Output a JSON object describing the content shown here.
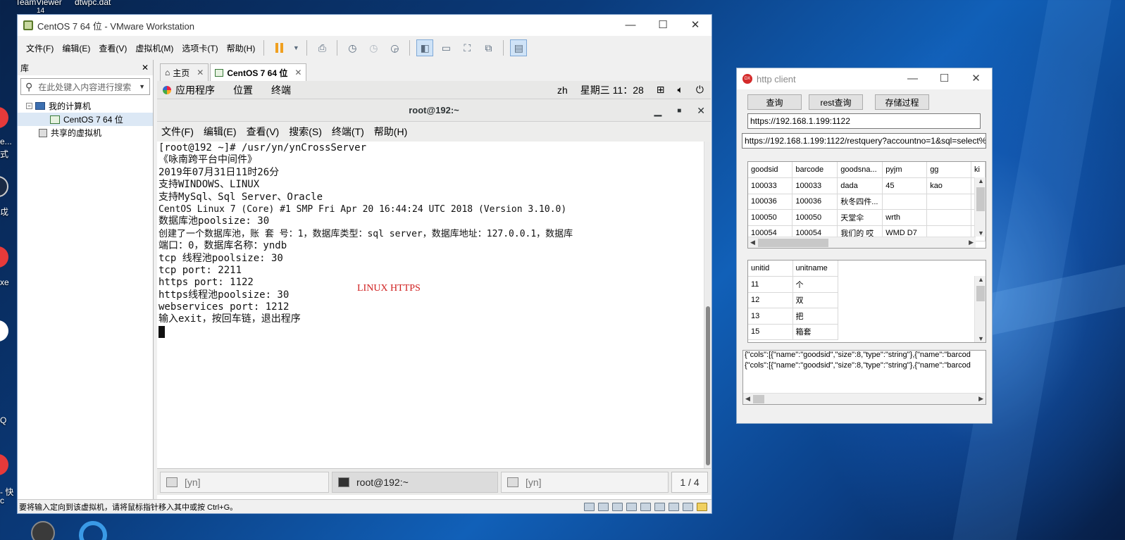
{
  "desktop": {
    "top_icons": [
      "TeamViewer",
      "dtwpc.dat"
    ],
    "top_sub": "14",
    "left_labels": [
      "e...",
      "式",
      "戉",
      "xe",
      "Q",
      "- 快",
      "c"
    ]
  },
  "vmware": {
    "title": "CentOS 7 64 位 - VMware Workstation",
    "controls": {
      "minimize": "—",
      "maximize": "☐",
      "close": "✕"
    },
    "menu": [
      "文件(F)",
      "编辑(E)",
      "查看(V)",
      "虚拟机(M)",
      "选项卡(T)",
      "帮助(H)"
    ],
    "library": {
      "title": "库",
      "close": "✕",
      "search_placeholder": "在此处键入内容进行搜索",
      "tree": {
        "root": "我的计算机",
        "vm": "CentOS 7 64 位",
        "shared": "共享的虚拟机"
      }
    },
    "tabs": [
      {
        "label": "主页"
      },
      {
        "label": "CentOS 7 64 位"
      }
    ],
    "status_text": "要将输入定向到该虚拟机，请将鼠标指针移入其中或按 Ctrl+G。"
  },
  "gnome": {
    "menu": [
      "应用程序",
      "位置",
      "终端"
    ],
    "lang": "zh",
    "clock": "星期三 11：28"
  },
  "terminal": {
    "title": "root@192:~",
    "menu": [
      "文件(F)",
      "编辑(E)",
      "查看(V)",
      "搜索(S)",
      "终端(T)",
      "帮助(H)"
    ],
    "lines": [
      "[root@192 ~]# /usr/yn/ynCrossServer",
      "《咏南跨平台中间件》",
      "2019年07月31日11时26分",
      "支持WINDOWS、LINUX",
      "支持MySql、Sql Server、Oracle",
      "CentOS Linux 7 (Core) #1 SMP Fri Apr 20 16:44:24 UTC 2018 (Version 3.10.0)",
      "数据库池poolsize: 30",
      "创建了一个数据库池，账 套 号：1，数据库类型：sql server，数据库地址：127.0.0.1，数据库",
      "端口：0，数据库名称：yndb",
      "tcp 线程池poolsize: 30",
      "tcp port: 2211",
      "https port: 1122",
      "https线程池poolsize: 30",
      "webservices port: 1212",
      "输入exit，按回车链，退出程序"
    ],
    "annotation": "LINUX HTTPS",
    "taskbar": [
      {
        "label": "[yn]"
      },
      {
        "label": "root@192:~"
      },
      {
        "label": "[yn]"
      }
    ],
    "pager": "1 / 4"
  },
  "http_client": {
    "title": "http client",
    "buttons": [
      "查询",
      "rest查询",
      "存储过程"
    ],
    "url": "https://192.168.1.199:1122",
    "rest_url": "https://192.168.1.199:1122/restquery?accountno=1&sql=select%2",
    "grid1": {
      "columns": [
        "goodsid",
        "barcode",
        "goodsna...",
        "pyjm",
        "gg",
        "ki"
      ],
      "rows": [
        [
          "100033",
          "100033",
          "dada",
          "45",
          "kao",
          ""
        ],
        [
          "100036",
          "100036",
          "秋冬四件...",
          "",
          "",
          ""
        ],
        [
          "100050",
          "100050",
          "天堂伞",
          "wrth",
          "",
          ""
        ],
        [
          "100054",
          "100054",
          "我们的 哎",
          "WMD D7",
          "",
          ""
        ]
      ]
    },
    "grid2": {
      "columns": [
        "unitid",
        "unitname"
      ],
      "rows": [
        [
          "11",
          "个"
        ],
        [
          "12",
          "双"
        ],
        [
          "13",
          "把"
        ],
        [
          "15",
          "箱套"
        ]
      ]
    },
    "memo": [
      "{\"cols\":[{\"name\":\"goodsid\",\"size\":8,\"type\":\"string\"},{\"name\":\"barcod",
      "{\"cols\":[{\"name\":\"goodsid\",\"size\":8,\"type\":\"string\"},{\"name\":\"barcod"
    ]
  }
}
